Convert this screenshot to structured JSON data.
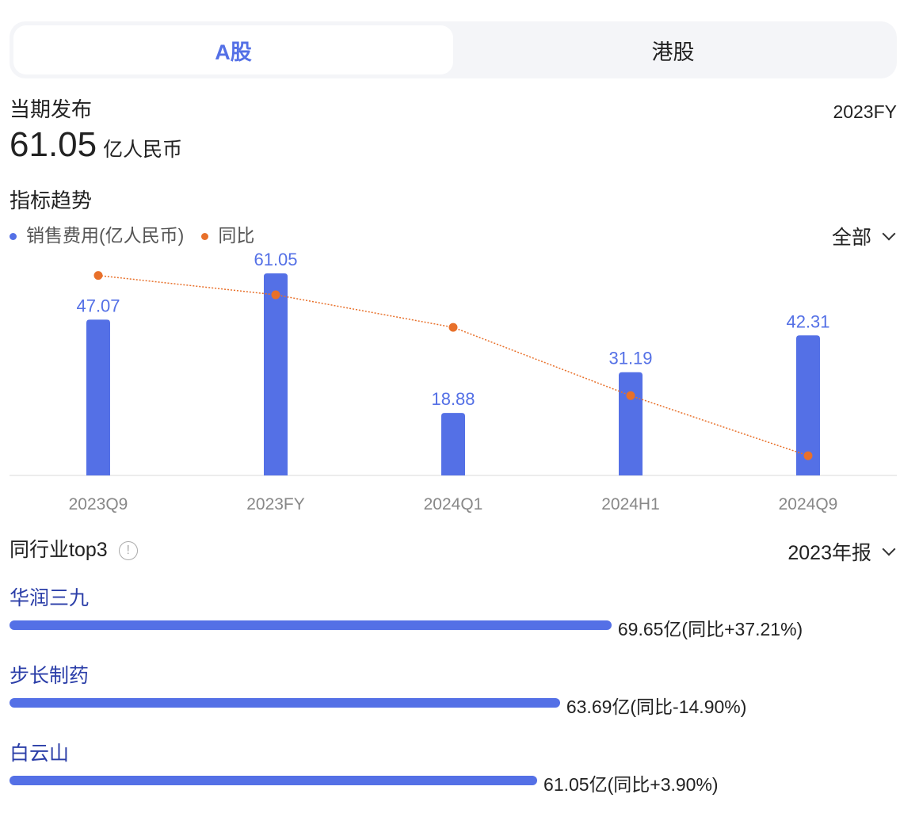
{
  "tabs": [
    {
      "label": "A股",
      "active": true
    },
    {
      "label": "港股",
      "active": false
    }
  ],
  "current": {
    "title": "当期发布",
    "value": "61.05",
    "unit": "亿人民币",
    "period": "2023FY"
  },
  "trend": {
    "title": "指标趋势",
    "legend": [
      "销售费用(亿人民币)",
      "同比"
    ],
    "filter": "全部"
  },
  "colors": {
    "accent": "#5470e6",
    "line": "#e8702a"
  },
  "chart_data": {
    "type": "bar",
    "categories": [
      "2023Q9",
      "2023FY",
      "2024Q1",
      "2024H1",
      "2024Q9"
    ],
    "series": [
      {
        "name": "销售费用(亿人民币)",
        "type": "bar",
        "values": [
          47.07,
          61.05,
          18.88,
          31.19,
          42.31
        ],
        "labels": [
          "47.07",
          "61.05",
          "18.88",
          "31.19",
          "42.31"
        ]
      },
      {
        "name": "同比",
        "type": "line",
        "values": [
          8.6,
          3.9,
          -4.0,
          -20.6,
          -35.2
        ],
        "unit": "%",
        "note": "estimated, unlabeled"
      }
    ],
    "ylim": [
      0,
      65
    ],
    "yoy_ylim": [
      -40,
      12
    ],
    "grid": false,
    "legend": "top-left"
  },
  "peers": {
    "title": "同行业top3",
    "filter": "2023年报",
    "items": [
      {
        "name": "华润三九",
        "value": 69.65,
        "label": "69.65亿(同比+37.21%)"
      },
      {
        "name": "步长制药",
        "value": 63.69,
        "label": "63.69亿(同比-14.90%)"
      },
      {
        "name": "白云山",
        "value": 61.05,
        "label": "61.05亿(同比+3.90%)"
      }
    ]
  }
}
